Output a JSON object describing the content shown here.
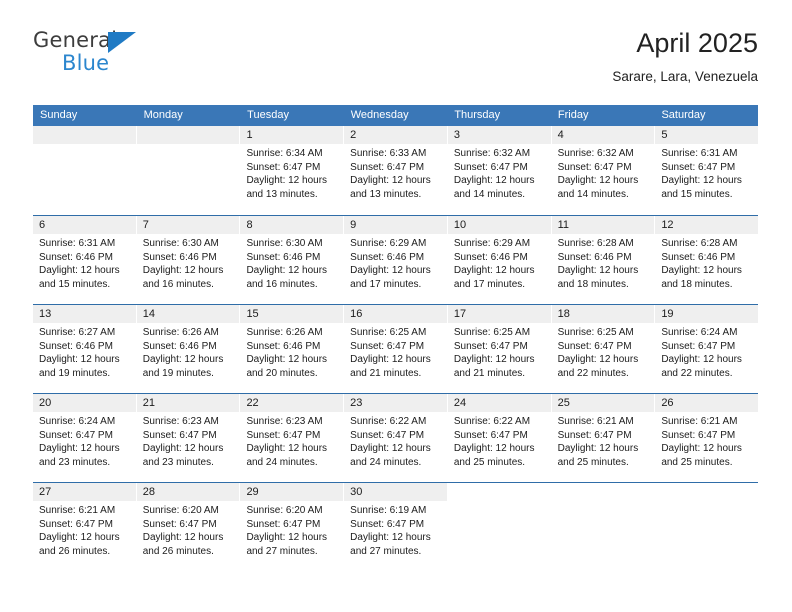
{
  "brand": {
    "name_part1": "General",
    "name_part2": "Blue",
    "triangle_color": "#1f7ac4",
    "blue_color": "#2b86ce"
  },
  "header": {
    "title": "April 2025",
    "location": "Sarare, Lara, Venezuela"
  },
  "theme": {
    "header_bar": "#3a77b7",
    "row_divider": "#2f6da8",
    "date_band": "#efefef"
  },
  "weekdays": [
    "Sunday",
    "Monday",
    "Tuesday",
    "Wednesday",
    "Thursday",
    "Friday",
    "Saturday"
  ],
  "labels": {
    "sunrise_prefix": "Sunrise: ",
    "sunset_prefix": "Sunset: ",
    "daylight_prefix": "Daylight: "
  },
  "weeks": [
    [
      {
        "day": "",
        "empty": true
      },
      {
        "day": "",
        "empty": true
      },
      {
        "day": "1",
        "sunrise": "Sunrise: 6:34 AM",
        "sunset": "Sunset: 6:47 PM",
        "daylight1": "Daylight: 12 hours",
        "daylight2": "and 13 minutes."
      },
      {
        "day": "2",
        "sunrise": "Sunrise: 6:33 AM",
        "sunset": "Sunset: 6:47 PM",
        "daylight1": "Daylight: 12 hours",
        "daylight2": "and 13 minutes."
      },
      {
        "day": "3",
        "sunrise": "Sunrise: 6:32 AM",
        "sunset": "Sunset: 6:47 PM",
        "daylight1": "Daylight: 12 hours",
        "daylight2": "and 14 minutes."
      },
      {
        "day": "4",
        "sunrise": "Sunrise: 6:32 AM",
        "sunset": "Sunset: 6:47 PM",
        "daylight1": "Daylight: 12 hours",
        "daylight2": "and 14 minutes."
      },
      {
        "day": "5",
        "sunrise": "Sunrise: 6:31 AM",
        "sunset": "Sunset: 6:47 PM",
        "daylight1": "Daylight: 12 hours",
        "daylight2": "and 15 minutes."
      }
    ],
    [
      {
        "day": "6",
        "sunrise": "Sunrise: 6:31 AM",
        "sunset": "Sunset: 6:46 PM",
        "daylight1": "Daylight: 12 hours",
        "daylight2": "and 15 minutes."
      },
      {
        "day": "7",
        "sunrise": "Sunrise: 6:30 AM",
        "sunset": "Sunset: 6:46 PM",
        "daylight1": "Daylight: 12 hours",
        "daylight2": "and 16 minutes."
      },
      {
        "day": "8",
        "sunrise": "Sunrise: 6:30 AM",
        "sunset": "Sunset: 6:46 PM",
        "daylight1": "Daylight: 12 hours",
        "daylight2": "and 16 minutes."
      },
      {
        "day": "9",
        "sunrise": "Sunrise: 6:29 AM",
        "sunset": "Sunset: 6:46 PM",
        "daylight1": "Daylight: 12 hours",
        "daylight2": "and 17 minutes."
      },
      {
        "day": "10",
        "sunrise": "Sunrise: 6:29 AM",
        "sunset": "Sunset: 6:46 PM",
        "daylight1": "Daylight: 12 hours",
        "daylight2": "and 17 minutes."
      },
      {
        "day": "11",
        "sunrise": "Sunrise: 6:28 AM",
        "sunset": "Sunset: 6:46 PM",
        "daylight1": "Daylight: 12 hours",
        "daylight2": "and 18 minutes."
      },
      {
        "day": "12",
        "sunrise": "Sunrise: 6:28 AM",
        "sunset": "Sunset: 6:46 PM",
        "daylight1": "Daylight: 12 hours",
        "daylight2": "and 18 minutes."
      }
    ],
    [
      {
        "day": "13",
        "sunrise": "Sunrise: 6:27 AM",
        "sunset": "Sunset: 6:46 PM",
        "daylight1": "Daylight: 12 hours",
        "daylight2": "and 19 minutes."
      },
      {
        "day": "14",
        "sunrise": "Sunrise: 6:26 AM",
        "sunset": "Sunset: 6:46 PM",
        "daylight1": "Daylight: 12 hours",
        "daylight2": "and 19 minutes."
      },
      {
        "day": "15",
        "sunrise": "Sunrise: 6:26 AM",
        "sunset": "Sunset: 6:46 PM",
        "daylight1": "Daylight: 12 hours",
        "daylight2": "and 20 minutes."
      },
      {
        "day": "16",
        "sunrise": "Sunrise: 6:25 AM",
        "sunset": "Sunset: 6:47 PM",
        "daylight1": "Daylight: 12 hours",
        "daylight2": "and 21 minutes."
      },
      {
        "day": "17",
        "sunrise": "Sunrise: 6:25 AM",
        "sunset": "Sunset: 6:47 PM",
        "daylight1": "Daylight: 12 hours",
        "daylight2": "and 21 minutes."
      },
      {
        "day": "18",
        "sunrise": "Sunrise: 6:25 AM",
        "sunset": "Sunset: 6:47 PM",
        "daylight1": "Daylight: 12 hours",
        "daylight2": "and 22 minutes."
      },
      {
        "day": "19",
        "sunrise": "Sunrise: 6:24 AM",
        "sunset": "Sunset: 6:47 PM",
        "daylight1": "Daylight: 12 hours",
        "daylight2": "and 22 minutes."
      }
    ],
    [
      {
        "day": "20",
        "sunrise": "Sunrise: 6:24 AM",
        "sunset": "Sunset: 6:47 PM",
        "daylight1": "Daylight: 12 hours",
        "daylight2": "and 23 minutes."
      },
      {
        "day": "21",
        "sunrise": "Sunrise: 6:23 AM",
        "sunset": "Sunset: 6:47 PM",
        "daylight1": "Daylight: 12 hours",
        "daylight2": "and 23 minutes."
      },
      {
        "day": "22",
        "sunrise": "Sunrise: 6:23 AM",
        "sunset": "Sunset: 6:47 PM",
        "daylight1": "Daylight: 12 hours",
        "daylight2": "and 24 minutes."
      },
      {
        "day": "23",
        "sunrise": "Sunrise: 6:22 AM",
        "sunset": "Sunset: 6:47 PM",
        "daylight1": "Daylight: 12 hours",
        "daylight2": "and 24 minutes."
      },
      {
        "day": "24",
        "sunrise": "Sunrise: 6:22 AM",
        "sunset": "Sunset: 6:47 PM",
        "daylight1": "Daylight: 12 hours",
        "daylight2": "and 25 minutes."
      },
      {
        "day": "25",
        "sunrise": "Sunrise: 6:21 AM",
        "sunset": "Sunset: 6:47 PM",
        "daylight1": "Daylight: 12 hours",
        "daylight2": "and 25 minutes."
      },
      {
        "day": "26",
        "sunrise": "Sunrise: 6:21 AM",
        "sunset": "Sunset: 6:47 PM",
        "daylight1": "Daylight: 12 hours",
        "daylight2": "and 25 minutes."
      }
    ],
    [
      {
        "day": "27",
        "sunrise": "Sunrise: 6:21 AM",
        "sunset": "Sunset: 6:47 PM",
        "daylight1": "Daylight: 12 hours",
        "daylight2": "and 26 minutes."
      },
      {
        "day": "28",
        "sunrise": "Sunrise: 6:20 AM",
        "sunset": "Sunset: 6:47 PM",
        "daylight1": "Daylight: 12 hours",
        "daylight2": "and 26 minutes."
      },
      {
        "day": "29",
        "sunrise": "Sunrise: 6:20 AM",
        "sunset": "Sunset: 6:47 PM",
        "daylight1": "Daylight: 12 hours",
        "daylight2": "and 27 minutes."
      },
      {
        "day": "30",
        "sunrise": "Sunrise: 6:19 AM",
        "sunset": "Sunset: 6:47 PM",
        "daylight1": "Daylight: 12 hours",
        "daylight2": "and 27 minutes."
      },
      {
        "day": "",
        "blank": true
      },
      {
        "day": "",
        "blank": true
      },
      {
        "day": "",
        "blank": true
      }
    ]
  ]
}
